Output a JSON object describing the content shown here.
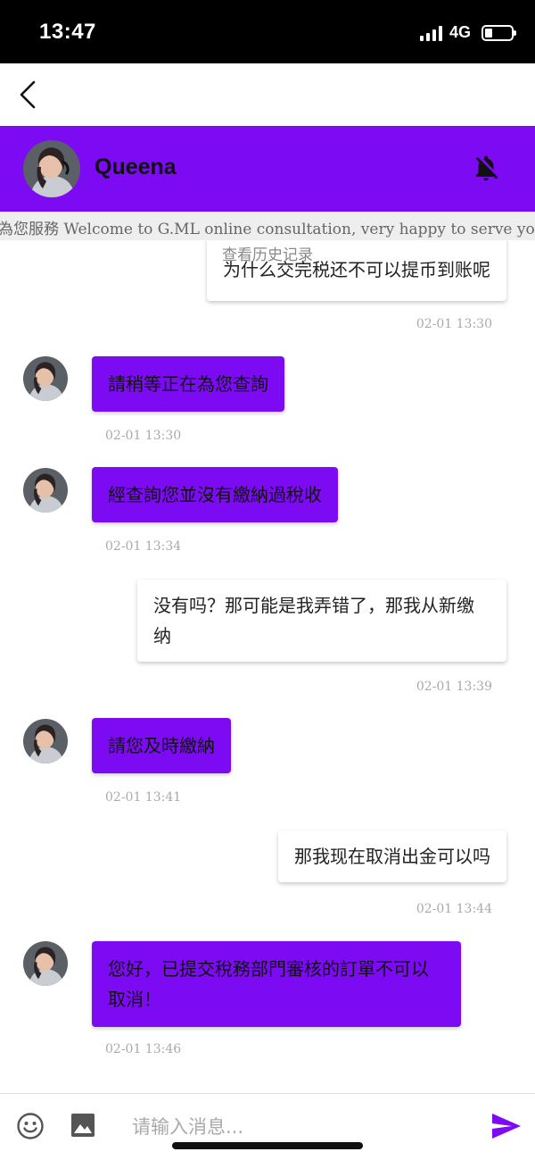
{
  "status_bar": {
    "time": "13:47",
    "network": "4G"
  },
  "header": {
    "contact_name": "Queena"
  },
  "notice": {
    "text": "為您服務 Welcome to G.ML online consultation, very happy to serve you"
  },
  "history_link": "查看历史记录",
  "messages": [
    {
      "side": "right",
      "text": "为什么交完税还不可以提币到账呢",
      "time": "02-01 13:30"
    },
    {
      "side": "left",
      "text": "請稍等正在為您查詢",
      "time": "02-01 13:30"
    },
    {
      "side": "left",
      "text": "經查詢您並沒有繳納過稅收",
      "time": "02-01 13:34"
    },
    {
      "side": "right",
      "text": "没有吗？那可能是我弄错了，那我从新缴纳",
      "time": "02-01 13:39"
    },
    {
      "side": "left",
      "text": "請您及時繳納",
      "time": "02-01 13:41"
    },
    {
      "side": "right",
      "text": "那我现在取消出金可以吗",
      "time": "02-01 13:44"
    },
    {
      "side": "left",
      "text": "您好，已提交稅務部門審核的訂單不可以取消！",
      "time": "02-01 13:46"
    }
  ],
  "input": {
    "placeholder": "请输入消息..."
  },
  "icons": {
    "back": "chevron-left-icon",
    "bell": "bell-off-icon",
    "emoji": "smiley-icon",
    "image": "image-icon",
    "send": "send-icon"
  },
  "colors": {
    "accent": "#7c0af2",
    "status_bar": "#000000"
  }
}
